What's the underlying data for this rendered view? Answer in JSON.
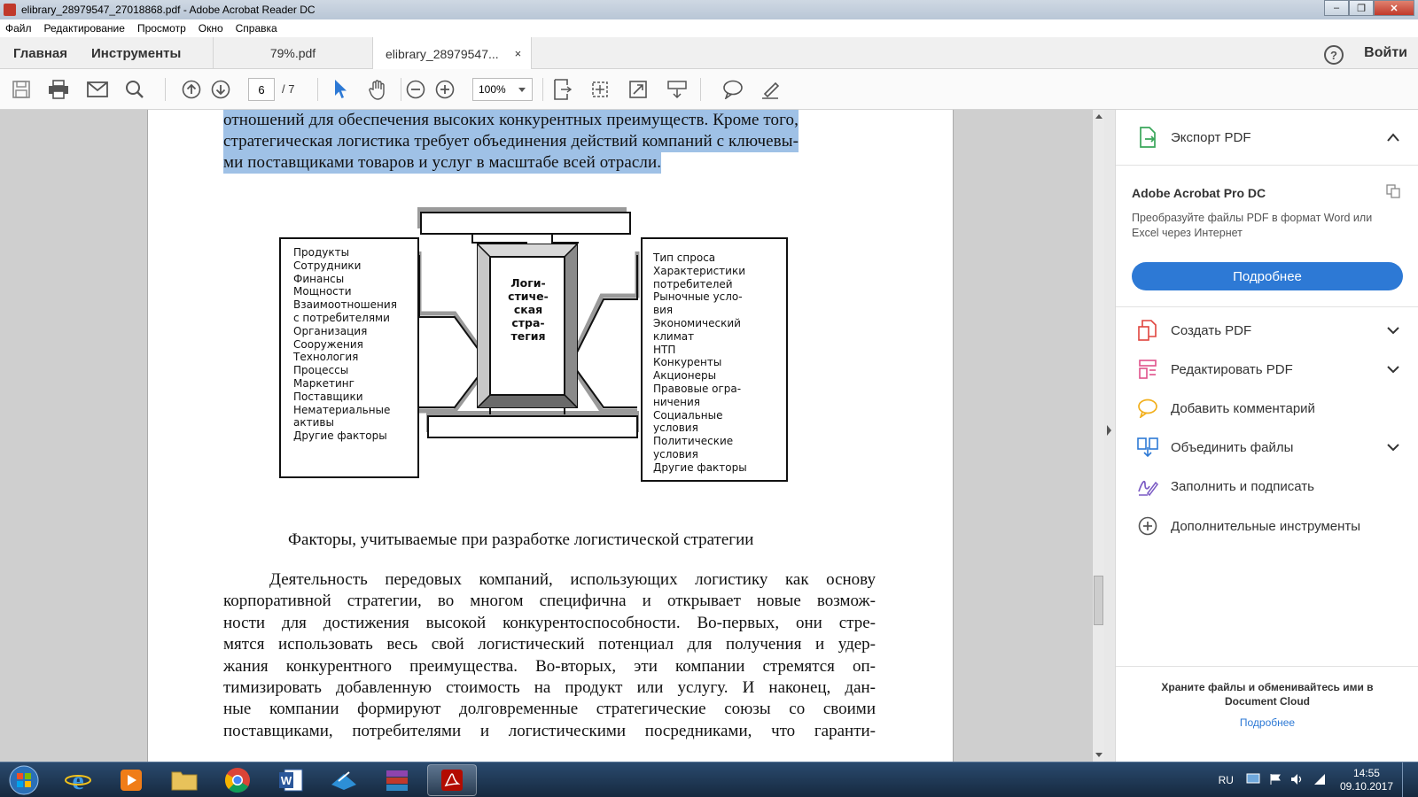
{
  "window": {
    "title": "elibrary_28979547_27018868.pdf - Adobe Acrobat Reader DC"
  },
  "menu": [
    "Файл",
    "Редактирование",
    "Просмотр",
    "Окно",
    "Справка"
  ],
  "tabs": {
    "home": "Главная",
    "tools": "Инструменты",
    "doc1": "79%.pdf",
    "doc2": "elibrary_28979547...",
    "close": "×",
    "help": "?",
    "signin": "Войти"
  },
  "toolbar": {
    "page_current": "6",
    "page_total": "/ 7",
    "zoom": "100%"
  },
  "document": {
    "highlighted_lines": [
      "отношений для обеспечения высоких конкурентных преимуществ. Кроме того,",
      "стратегическая логистика требует объединения действий компаний с ключевы-",
      "ми поставщиками товаров и услуг в масштабе всей отрасли."
    ],
    "diagram": {
      "center": "Логи-\nстиче-\nская\nстра-\nтегия",
      "left": "Продукты\nСотрудники\nФинансы\nМощности\nВзаимоотношения\nс потребителями\nОрганизация\nСооружения\nТехнология\nПроцессы\nМаркетинг\nПоставщики\nНематериальные\nактивы\nДругие факторы",
      "right": "Тип спроса\nХарактеристики\nпотребителей\nРыночные усло-\nвия\nЭкономический\nклимат\nНТП\nКонкуренты\nАкционеры\nПравовые огра-\nничения\nСоциальные\nусловия\nПолитические\nусловия\nДругие факторы"
    },
    "caption": "Факторы, учитываемые при разработке логистической стратегии",
    "body_lines": [
      "Деятельность передовых компаний, использующих логистику как основу",
      "корпоративной стратегии, во многом специфична и открывает новые возмож-",
      "ности для достижения высокой конкурентоспособности. Во-первых, они стре-",
      "мятся использовать весь свой логистический потенциал для получения и удер-",
      "жания конкурентного преимущества. Во-вторых, эти компании стремятся оп-",
      "тимизировать добавленную стоимость на продукт или услугу. И наконец, дан-",
      "ные компании формируют долговременные стратегические союзы со своими",
      "поставщиками, потребителями и логистическими посредниками, что гаранти-"
    ]
  },
  "panel": {
    "export": "Экспорт PDF",
    "product": "Adobe Acrobat Pro DC",
    "desc_line1": "Преобразуйте файлы PDF в формат Word или",
    "desc_line2": "Excel через Интернет",
    "learn_more": "Подробнее",
    "tools": [
      {
        "label": "Создать PDF",
        "icon": "create-pdf-icon",
        "color": "#e0443e",
        "chevron": true
      },
      {
        "label": "Редактировать PDF",
        "icon": "edit-pdf-icon",
        "color": "#e0518b",
        "chevron": true
      },
      {
        "label": "Добавить комментарий",
        "icon": "comment-icon",
        "color": "#f2b01e",
        "chevron": false
      },
      {
        "label": "Объединить файлы",
        "icon": "combine-files-icon",
        "color": "#2d79d5",
        "chevron": true
      },
      {
        "label": "Заполнить и подписать",
        "icon": "fill-sign-icon",
        "color": "#7b5bc4",
        "chevron": false
      },
      {
        "label": "Дополнительные инструменты",
        "icon": "more-tools-icon",
        "color": "#555555",
        "chevron": false
      }
    ],
    "cloud_line1": "Храните файлы и обменивайтесь ими в",
    "cloud_line2": "Document Cloud",
    "cloud_link": "Подробнее"
  },
  "taskbar": {
    "lang": "RU",
    "time": "14:55",
    "date": "09.10.2017"
  }
}
